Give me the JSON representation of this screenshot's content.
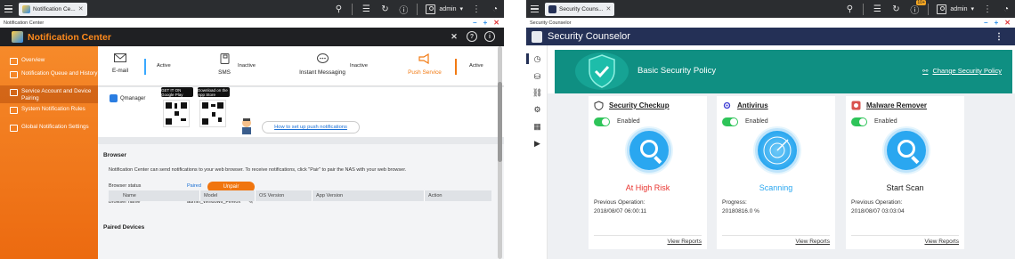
{
  "left": {
    "tab_title": "Notification Ce...",
    "window_title": "Notification Center",
    "user": "admin",
    "app_title": "Notification Center",
    "sidebar": [
      {
        "label": "Overview",
        "selected": false
      },
      {
        "label": "Notification Queue and History",
        "selected": false
      },
      {
        "label": "Service Account and Device Pairing",
        "selected": true
      },
      {
        "label": "System Notification Rules",
        "selected": false
      },
      {
        "label": "Global Notification Settings",
        "selected": false
      }
    ],
    "channels": [
      {
        "label": "E-mail",
        "status": "Active"
      },
      {
        "label": "SMS",
        "status": "Inactive"
      },
      {
        "label": "Instant Messaging",
        "status": "Inactive"
      },
      {
        "label": "Push Service",
        "status": "Active"
      }
    ],
    "qmanager": "Qmanager",
    "google_play": "GET IT ON Google Play",
    "app_store": "Download on the App Store",
    "howto": "How to set up push notifications",
    "browser": {
      "heading": "Browser",
      "description": "Notification Center can send notifications to your web browser. To receive notifications, click \"Pair\" to pair the NAS with your web browser.",
      "status_label": "Browser status",
      "status_value": "Paired",
      "unpair": "Unpair",
      "name_label": "Browser name",
      "name_value": "admin_Windows_Firefox"
    },
    "paired": {
      "heading": "Paired Devices",
      "columns": [
        "Name",
        "Model",
        "OS Version",
        "App Version",
        "Action"
      ]
    }
  },
  "right": {
    "tab_title": "Security Couns...",
    "window_title": "Security Counselor",
    "user": "admin",
    "badge": "10+",
    "app_title": "Security Counselor",
    "policy_title": "Basic Security Policy",
    "change_policy": "Change Security Policy",
    "cards": [
      {
        "title": "Security Checkup",
        "toggle": "Enabled",
        "status": "At High Risk",
        "status_color": "#e8342f",
        "line1": "Previous Operation:",
        "line2": "2018/08/07 06:00:11",
        "link": "View Reports"
      },
      {
        "title": "Antivirus",
        "toggle": "Enabled",
        "status": "Scanning",
        "status_color": "#2aa7f0",
        "line1": "Progress:",
        "line2": "20180816.0 %",
        "link": "View Reports"
      },
      {
        "title": "Malware Remover",
        "toggle": "Enabled",
        "status": "Start Scan",
        "status_color": "#222222",
        "line1": "Previous Operation:",
        "line2": "2018/08/07 03:03:04",
        "link": "View Reports"
      }
    ]
  }
}
